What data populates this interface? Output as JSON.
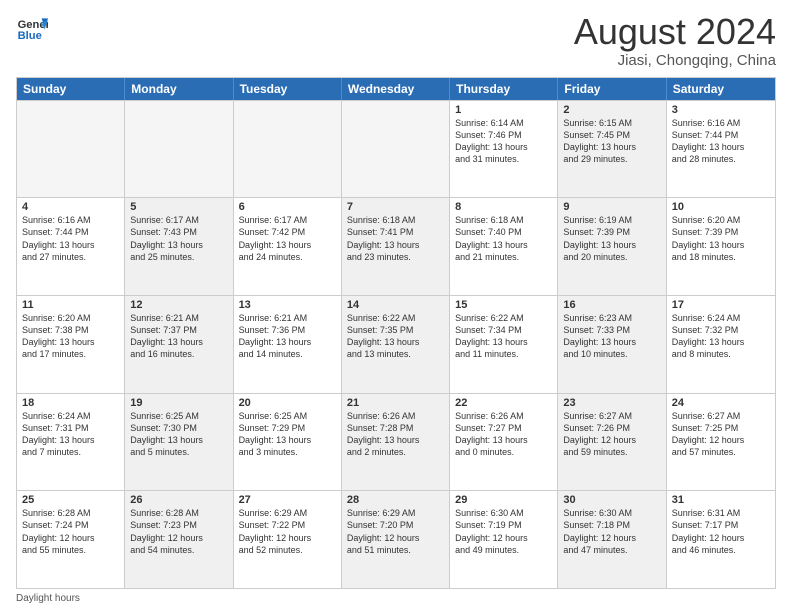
{
  "header": {
    "logo_line1": "General",
    "logo_line2": "Blue",
    "main_title": "August 2024",
    "subtitle": "Jiasi, Chongqing, China"
  },
  "days_of_week": [
    "Sunday",
    "Monday",
    "Tuesday",
    "Wednesday",
    "Thursday",
    "Friday",
    "Saturday"
  ],
  "weeks": [
    [
      {
        "day": "",
        "info": "",
        "shaded": false,
        "empty": true
      },
      {
        "day": "",
        "info": "",
        "shaded": false,
        "empty": true
      },
      {
        "day": "",
        "info": "",
        "shaded": false,
        "empty": true
      },
      {
        "day": "",
        "info": "",
        "shaded": false,
        "empty": true
      },
      {
        "day": "1",
        "info": "Sunrise: 6:14 AM\nSunset: 7:46 PM\nDaylight: 13 hours\nand 31 minutes.",
        "shaded": false,
        "empty": false
      },
      {
        "day": "2",
        "info": "Sunrise: 6:15 AM\nSunset: 7:45 PM\nDaylight: 13 hours\nand 29 minutes.",
        "shaded": true,
        "empty": false
      },
      {
        "day": "3",
        "info": "Sunrise: 6:16 AM\nSunset: 7:44 PM\nDaylight: 13 hours\nand 28 minutes.",
        "shaded": false,
        "empty": false
      }
    ],
    [
      {
        "day": "4",
        "info": "Sunrise: 6:16 AM\nSunset: 7:44 PM\nDaylight: 13 hours\nand 27 minutes.",
        "shaded": false,
        "empty": false
      },
      {
        "day": "5",
        "info": "Sunrise: 6:17 AM\nSunset: 7:43 PM\nDaylight: 13 hours\nand 25 minutes.",
        "shaded": true,
        "empty": false
      },
      {
        "day": "6",
        "info": "Sunrise: 6:17 AM\nSunset: 7:42 PM\nDaylight: 13 hours\nand 24 minutes.",
        "shaded": false,
        "empty": false
      },
      {
        "day": "7",
        "info": "Sunrise: 6:18 AM\nSunset: 7:41 PM\nDaylight: 13 hours\nand 23 minutes.",
        "shaded": true,
        "empty": false
      },
      {
        "day": "8",
        "info": "Sunrise: 6:18 AM\nSunset: 7:40 PM\nDaylight: 13 hours\nand 21 minutes.",
        "shaded": false,
        "empty": false
      },
      {
        "day": "9",
        "info": "Sunrise: 6:19 AM\nSunset: 7:39 PM\nDaylight: 13 hours\nand 20 minutes.",
        "shaded": true,
        "empty": false
      },
      {
        "day": "10",
        "info": "Sunrise: 6:20 AM\nSunset: 7:39 PM\nDaylight: 13 hours\nand 18 minutes.",
        "shaded": false,
        "empty": false
      }
    ],
    [
      {
        "day": "11",
        "info": "Sunrise: 6:20 AM\nSunset: 7:38 PM\nDaylight: 13 hours\nand 17 minutes.",
        "shaded": false,
        "empty": false
      },
      {
        "day": "12",
        "info": "Sunrise: 6:21 AM\nSunset: 7:37 PM\nDaylight: 13 hours\nand 16 minutes.",
        "shaded": true,
        "empty": false
      },
      {
        "day": "13",
        "info": "Sunrise: 6:21 AM\nSunset: 7:36 PM\nDaylight: 13 hours\nand 14 minutes.",
        "shaded": false,
        "empty": false
      },
      {
        "day": "14",
        "info": "Sunrise: 6:22 AM\nSunset: 7:35 PM\nDaylight: 13 hours\nand 13 minutes.",
        "shaded": true,
        "empty": false
      },
      {
        "day": "15",
        "info": "Sunrise: 6:22 AM\nSunset: 7:34 PM\nDaylight: 13 hours\nand 11 minutes.",
        "shaded": false,
        "empty": false
      },
      {
        "day": "16",
        "info": "Sunrise: 6:23 AM\nSunset: 7:33 PM\nDaylight: 13 hours\nand 10 minutes.",
        "shaded": true,
        "empty": false
      },
      {
        "day": "17",
        "info": "Sunrise: 6:24 AM\nSunset: 7:32 PM\nDaylight: 13 hours\nand 8 minutes.",
        "shaded": false,
        "empty": false
      }
    ],
    [
      {
        "day": "18",
        "info": "Sunrise: 6:24 AM\nSunset: 7:31 PM\nDaylight: 13 hours\nand 7 minutes.",
        "shaded": false,
        "empty": false
      },
      {
        "day": "19",
        "info": "Sunrise: 6:25 AM\nSunset: 7:30 PM\nDaylight: 13 hours\nand 5 minutes.",
        "shaded": true,
        "empty": false
      },
      {
        "day": "20",
        "info": "Sunrise: 6:25 AM\nSunset: 7:29 PM\nDaylight: 13 hours\nand 3 minutes.",
        "shaded": false,
        "empty": false
      },
      {
        "day": "21",
        "info": "Sunrise: 6:26 AM\nSunset: 7:28 PM\nDaylight: 13 hours\nand 2 minutes.",
        "shaded": true,
        "empty": false
      },
      {
        "day": "22",
        "info": "Sunrise: 6:26 AM\nSunset: 7:27 PM\nDaylight: 13 hours\nand 0 minutes.",
        "shaded": false,
        "empty": false
      },
      {
        "day": "23",
        "info": "Sunrise: 6:27 AM\nSunset: 7:26 PM\nDaylight: 12 hours\nand 59 minutes.",
        "shaded": true,
        "empty": false
      },
      {
        "day": "24",
        "info": "Sunrise: 6:27 AM\nSunset: 7:25 PM\nDaylight: 12 hours\nand 57 minutes.",
        "shaded": false,
        "empty": false
      }
    ],
    [
      {
        "day": "25",
        "info": "Sunrise: 6:28 AM\nSunset: 7:24 PM\nDaylight: 12 hours\nand 55 minutes.",
        "shaded": false,
        "empty": false
      },
      {
        "day": "26",
        "info": "Sunrise: 6:28 AM\nSunset: 7:23 PM\nDaylight: 12 hours\nand 54 minutes.",
        "shaded": true,
        "empty": false
      },
      {
        "day": "27",
        "info": "Sunrise: 6:29 AM\nSunset: 7:22 PM\nDaylight: 12 hours\nand 52 minutes.",
        "shaded": false,
        "empty": false
      },
      {
        "day": "28",
        "info": "Sunrise: 6:29 AM\nSunset: 7:20 PM\nDaylight: 12 hours\nand 51 minutes.",
        "shaded": true,
        "empty": false
      },
      {
        "day": "29",
        "info": "Sunrise: 6:30 AM\nSunset: 7:19 PM\nDaylight: 12 hours\nand 49 minutes.",
        "shaded": false,
        "empty": false
      },
      {
        "day": "30",
        "info": "Sunrise: 6:30 AM\nSunset: 7:18 PM\nDaylight: 12 hours\nand 47 minutes.",
        "shaded": true,
        "empty": false
      },
      {
        "day": "31",
        "info": "Sunrise: 6:31 AM\nSunset: 7:17 PM\nDaylight: 12 hours\nand 46 minutes.",
        "shaded": false,
        "empty": false
      }
    ]
  ],
  "footer": {
    "daylight_label": "Daylight hours"
  }
}
